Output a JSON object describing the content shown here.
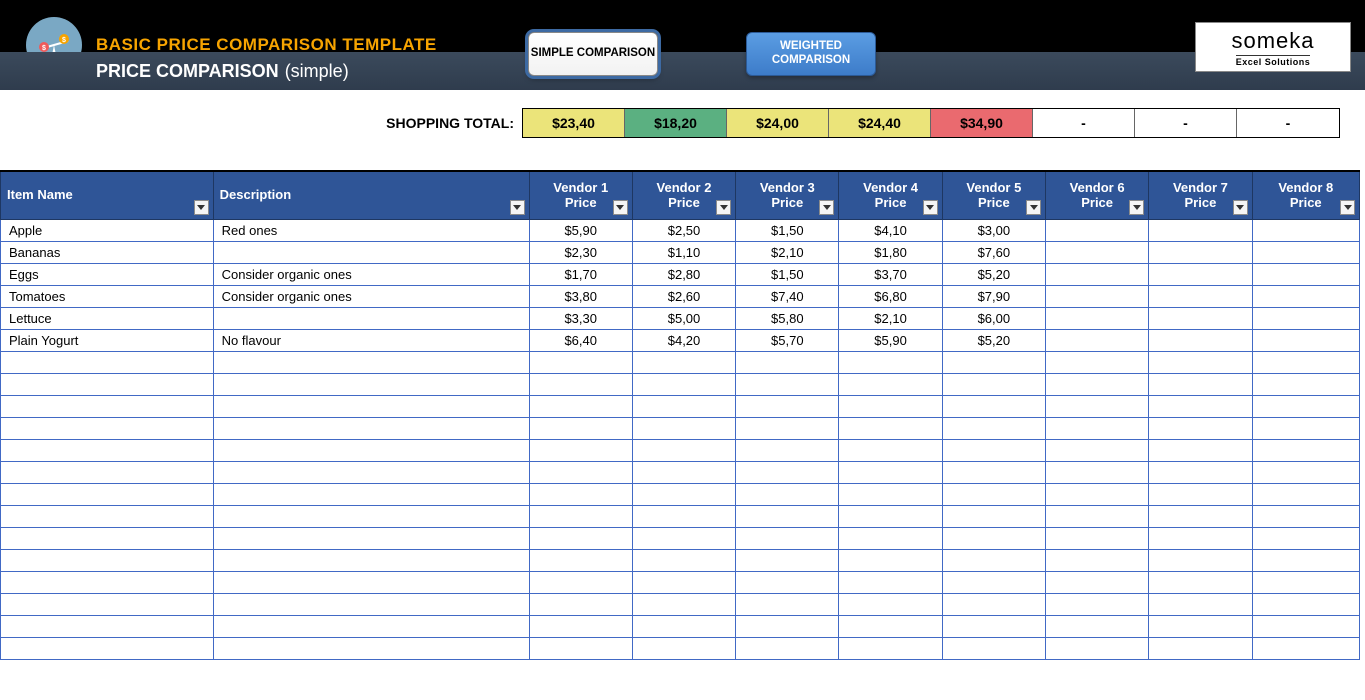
{
  "header": {
    "title": "BASIC PRICE COMPARISON TEMPLATE",
    "subtitle_bold": "PRICE COMPARISON",
    "subtitle_light": "(simple)",
    "tab_simple": "SIMPLE COMPARISON",
    "tab_weighted": "WEIGHTED COMPARISON",
    "logo_main": "someka",
    "logo_sub": "Excel Solutions"
  },
  "totals": {
    "label": "SHOPPING TOTAL:",
    "cells": [
      {
        "value": "$23,40",
        "color": "c-yellow"
      },
      {
        "value": "$18,20",
        "color": "c-green"
      },
      {
        "value": "$24,00",
        "color": "c-yellow"
      },
      {
        "value": "$24,40",
        "color": "c-yellow"
      },
      {
        "value": "$34,90",
        "color": "c-red"
      },
      {
        "value": "-",
        "color": "c-blank"
      },
      {
        "value": "-",
        "color": "c-blank"
      },
      {
        "value": "-",
        "color": "c-blank"
      }
    ]
  },
  "table": {
    "headers": {
      "item": "Item Name",
      "desc": "Description",
      "vendors": [
        "Vendor 1 Price",
        "Vendor 2 Price",
        "Vendor 3 Price",
        "Vendor 4 Price",
        "Vendor 5 Price",
        "Vendor 6 Price",
        "Vendor 7 Price",
        "Vendor 8 Price"
      ]
    },
    "rows": [
      {
        "item": "Apple",
        "desc": "Red ones",
        "prices": [
          "$5,90",
          "$2,50",
          "$1,50",
          "$4,10",
          "$3,00",
          "",
          "",
          ""
        ]
      },
      {
        "item": "Bananas",
        "desc": "",
        "prices": [
          "$2,30",
          "$1,10",
          "$2,10",
          "$1,80",
          "$7,60",
          "",
          "",
          ""
        ]
      },
      {
        "item": "Eggs",
        "desc": "Consider organic ones",
        "prices": [
          "$1,70",
          "$2,80",
          "$1,50",
          "$3,70",
          "$5,20",
          "",
          "",
          ""
        ]
      },
      {
        "item": "Tomatoes",
        "desc": "Consider organic ones",
        "prices": [
          "$3,80",
          "$2,60",
          "$7,40",
          "$6,80",
          "$7,90",
          "",
          "",
          ""
        ]
      },
      {
        "item": "Lettuce",
        "desc": "",
        "prices": [
          "$3,30",
          "$5,00",
          "$5,80",
          "$2,10",
          "$6,00",
          "",
          "",
          ""
        ]
      },
      {
        "item": "Plain Yogurt",
        "desc": "No flavour",
        "prices": [
          "$6,40",
          "$4,20",
          "$5,70",
          "$5,90",
          "$5,20",
          "",
          "",
          ""
        ]
      }
    ],
    "empty_rows": 14
  }
}
